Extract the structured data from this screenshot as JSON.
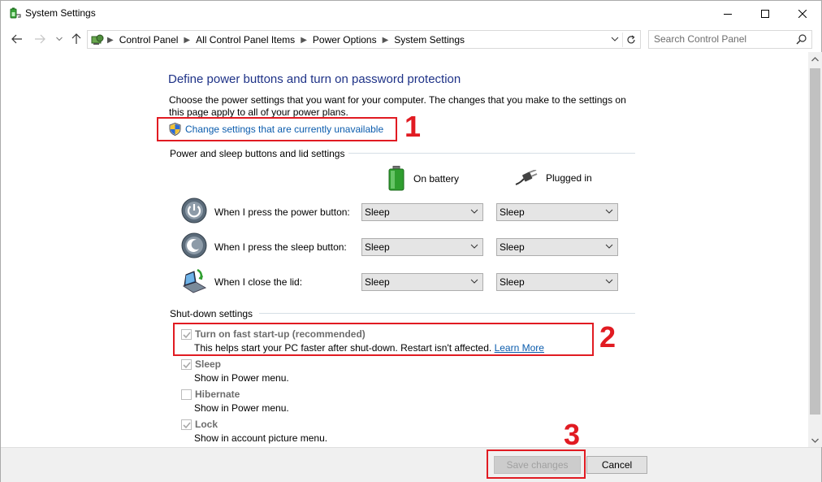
{
  "window": {
    "title": "System Settings"
  },
  "address": {
    "crumbs": [
      "Control Panel",
      "All Control Panel Items",
      "Power Options",
      "System Settings"
    ],
    "search_placeholder": "Search Control Panel"
  },
  "page": {
    "heading": "Define power buttons and turn on password protection",
    "description": "Choose the power settings that you want for your computer. The changes that you make to the settings on this page apply to all of your power plans.",
    "change_link": "Change settings that are currently unavailable",
    "section_buttons": "Power and sleep buttons and lid settings",
    "col_battery": "On battery",
    "col_plugged": "Plugged in",
    "rows": [
      {
        "label": "When I press the power button:",
        "battery": "Sleep",
        "plugged": "Sleep"
      },
      {
        "label": "When I press the sleep button:",
        "battery": "Sleep",
        "plugged": "Sleep"
      },
      {
        "label": "When I close the lid:",
        "battery": "Sleep",
        "plugged": "Sleep"
      }
    ],
    "section_shutdown": "Shut-down settings",
    "shutdown": [
      {
        "title": "Turn on fast start-up (recommended)",
        "sub": "This helps start your PC faster after shut-down. Restart isn't affected.",
        "link": "Learn More",
        "checked": true
      },
      {
        "title": "Sleep",
        "sub": "Show in Power menu.",
        "checked": true
      },
      {
        "title": "Hibernate",
        "sub": "Show in Power menu.",
        "checked": false
      },
      {
        "title": "Lock",
        "sub": "Show in account picture menu.",
        "checked": true
      }
    ]
  },
  "annotations": {
    "one": "1",
    "two": "2",
    "three": "3",
    "color": "#e11b22"
  },
  "footer": {
    "save": "Save changes",
    "cancel": "Cancel"
  }
}
